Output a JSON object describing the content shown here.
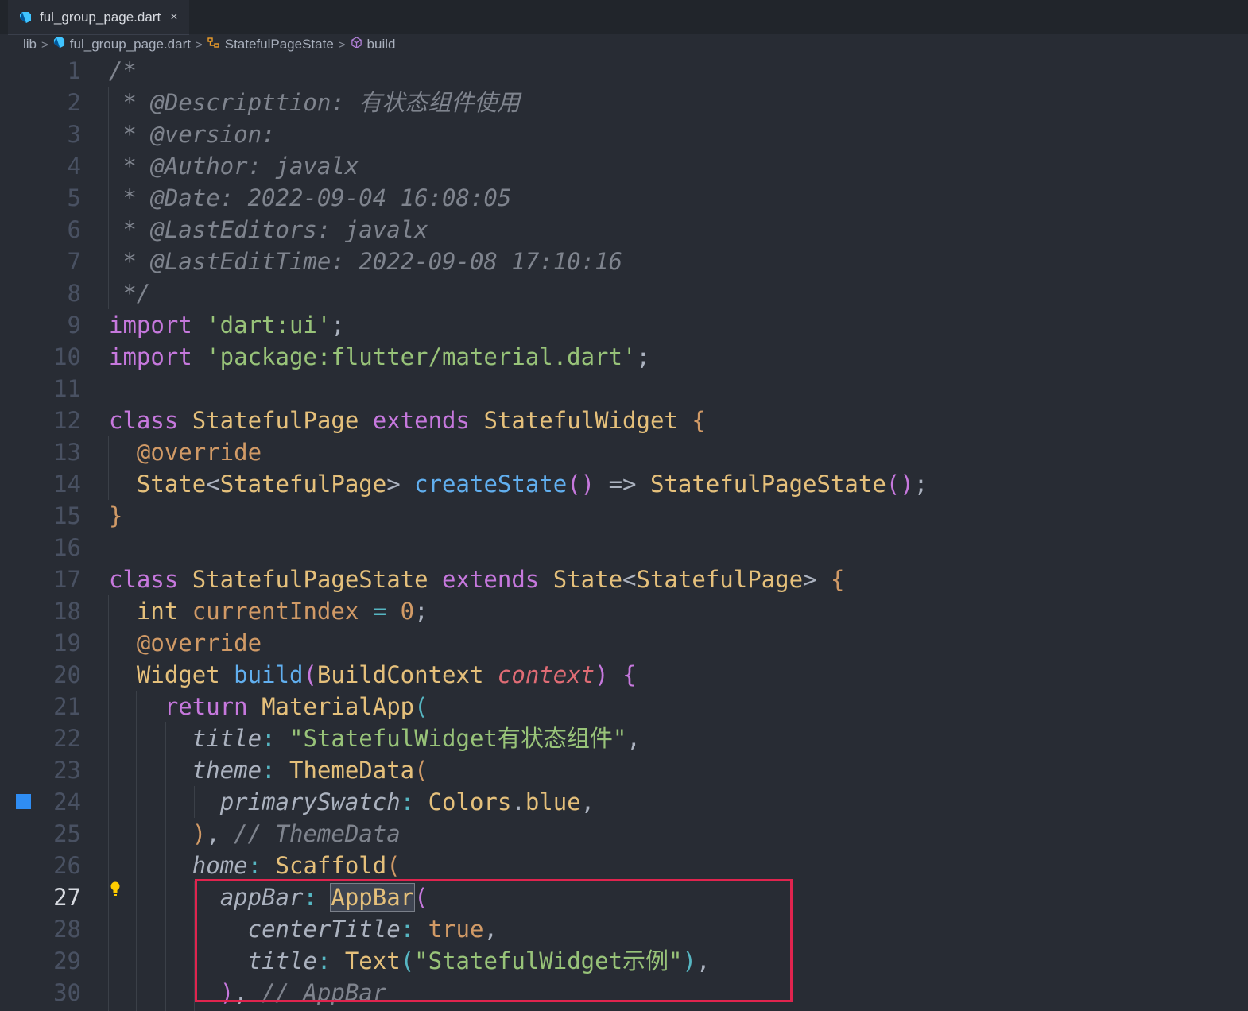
{
  "tab": {
    "filename": "ful_group_page.dart",
    "close_glyph": "×",
    "icon": "dart-icon"
  },
  "breadcrumb": {
    "items": [
      "lib",
      "ful_group_page.dart",
      "StatefulPageState",
      "build"
    ],
    "separator": ">"
  },
  "editor": {
    "active_line": 27,
    "modified_line": 24,
    "lines": [
      {
        "n": "1",
        "tokens": [
          [
            "c",
            "/*"
          ]
        ]
      },
      {
        "n": "2",
        "tokens": [
          [
            "c",
            " * @Descripttion: 有状态组件使用"
          ]
        ]
      },
      {
        "n": "3",
        "tokens": [
          [
            "c",
            " * @version:"
          ]
        ]
      },
      {
        "n": "4",
        "tokens": [
          [
            "c",
            " * @Author: javalx"
          ]
        ]
      },
      {
        "n": "5",
        "tokens": [
          [
            "c",
            " * @Date: 2022-09-04 16:08:05"
          ]
        ]
      },
      {
        "n": "6",
        "tokens": [
          [
            "c",
            " * @LastEditors: javalx"
          ]
        ]
      },
      {
        "n": "7",
        "tokens": [
          [
            "c",
            " * @LastEditTime: 2022-09-08 17:10:16"
          ]
        ]
      },
      {
        "n": "8",
        "tokens": [
          [
            "c",
            " */"
          ]
        ]
      },
      {
        "n": "9",
        "tokens": [
          [
            "kw",
            "import "
          ],
          [
            "str",
            "'dart:ui'"
          ],
          [
            "pun",
            ";"
          ]
        ]
      },
      {
        "n": "10",
        "tokens": [
          [
            "kw",
            "import "
          ],
          [
            "str",
            "'package:flutter/material.dart'"
          ],
          [
            "pun",
            ";"
          ]
        ]
      },
      {
        "n": "11",
        "tokens": []
      },
      {
        "n": "12",
        "tokens": [
          [
            "kw",
            "class "
          ],
          [
            "ty",
            "StatefulPage "
          ],
          [
            "kw",
            "extends "
          ],
          [
            "ty",
            "StatefulWidget "
          ],
          [
            "br1",
            "{"
          ]
        ]
      },
      {
        "n": "13",
        "tokens": [
          [
            "pun",
            "  "
          ],
          [
            "ann",
            "@override"
          ]
        ]
      },
      {
        "n": "14",
        "tokens": [
          [
            "pun",
            "  "
          ],
          [
            "ty",
            "State"
          ],
          [
            "pun",
            "<"
          ],
          [
            "ty",
            "StatefulPage"
          ],
          [
            "pun",
            "> "
          ],
          [
            "fn",
            "createState"
          ],
          [
            "br2",
            "()"
          ],
          [
            "pun",
            " => "
          ],
          [
            "ty",
            "StatefulPageState"
          ],
          [
            "br2",
            "()"
          ],
          [
            "pun",
            ";"
          ]
        ]
      },
      {
        "n": "15",
        "tokens": [
          [
            "br1",
            "}"
          ]
        ]
      },
      {
        "n": "16",
        "tokens": []
      },
      {
        "n": "17",
        "tokens": [
          [
            "kw",
            "class "
          ],
          [
            "ty",
            "StatefulPageState "
          ],
          [
            "kw",
            "extends "
          ],
          [
            "ty",
            "State"
          ],
          [
            "pun",
            "<"
          ],
          [
            "ty",
            "StatefulPage"
          ],
          [
            "pun",
            "> "
          ],
          [
            "br1",
            "{"
          ]
        ]
      },
      {
        "n": "18",
        "tokens": [
          [
            "pun",
            "  "
          ],
          [
            "ty",
            "int "
          ],
          [
            "num",
            "currentIndex"
          ],
          [
            "op",
            " = "
          ],
          [
            "num",
            "0"
          ],
          [
            "pun",
            ";"
          ]
        ]
      },
      {
        "n": "19",
        "tokens": [
          [
            "pun",
            "  "
          ],
          [
            "ann",
            "@override"
          ]
        ]
      },
      {
        "n": "20",
        "tokens": [
          [
            "pun",
            "  "
          ],
          [
            "ty",
            "Widget "
          ],
          [
            "fn",
            "build"
          ],
          [
            "br2",
            "("
          ],
          [
            "ty",
            "BuildContext "
          ],
          [
            "par",
            "context"
          ],
          [
            "br2",
            ")"
          ],
          [
            "pun",
            " "
          ],
          [
            "br2",
            "{"
          ]
        ]
      },
      {
        "n": "21",
        "tokens": [
          [
            "pun",
            "    "
          ],
          [
            "kw",
            "return "
          ],
          [
            "ty",
            "MaterialApp"
          ],
          [
            "br3",
            "("
          ]
        ]
      },
      {
        "n": "22",
        "tokens": [
          [
            "pun",
            "      "
          ],
          [
            "nm",
            "title"
          ],
          [
            "op",
            ": "
          ],
          [
            "str",
            "\"StatefulWidget有状态组件\""
          ],
          [
            "pun",
            ","
          ]
        ]
      },
      {
        "n": "23",
        "tokens": [
          [
            "pun",
            "      "
          ],
          [
            "nm",
            "theme"
          ],
          [
            "op",
            ": "
          ],
          [
            "ty",
            "ThemeData"
          ],
          [
            "br1",
            "("
          ]
        ]
      },
      {
        "n": "24",
        "tokens": [
          [
            "pun",
            "        "
          ],
          [
            "nm",
            "primarySwatch"
          ],
          [
            "op",
            ": "
          ],
          [
            "ty",
            "Colors"
          ],
          [
            "pun",
            "."
          ],
          [
            "prop",
            "blue"
          ],
          [
            "pun",
            ","
          ]
        ]
      },
      {
        "n": "25",
        "tokens": [
          [
            "pun",
            "      "
          ],
          [
            "br1",
            ")"
          ],
          [
            "pun",
            ", "
          ],
          [
            "c",
            "// ThemeData"
          ]
        ]
      },
      {
        "n": "26",
        "tokens": [
          [
            "pun",
            "      "
          ],
          [
            "nm",
            "home"
          ],
          [
            "op",
            ": "
          ],
          [
            "ty",
            "Scaffold"
          ],
          [
            "br1",
            "("
          ]
        ]
      },
      {
        "n": "27",
        "tokens": [
          [
            "pun",
            "        "
          ],
          [
            "nm",
            "appBar"
          ],
          [
            "op",
            ": "
          ],
          [
            "tyhl",
            "AppBar"
          ],
          [
            "br2",
            "("
          ]
        ]
      },
      {
        "n": "28",
        "tokens": [
          [
            "pun",
            "          "
          ],
          [
            "nm",
            "centerTitle"
          ],
          [
            "op",
            ": "
          ],
          [
            "num",
            "true"
          ],
          [
            "pun",
            ","
          ]
        ]
      },
      {
        "n": "29",
        "tokens": [
          [
            "pun",
            "          "
          ],
          [
            "nm",
            "title"
          ],
          [
            "op",
            ": "
          ],
          [
            "ty",
            "Text"
          ],
          [
            "br3",
            "("
          ],
          [
            "str",
            "\"StatefulWidget示例\""
          ],
          [
            "br3",
            ")"
          ],
          [
            "pun",
            ","
          ]
        ]
      },
      {
        "n": "30",
        "tokens": [
          [
            "pun",
            "        "
          ],
          [
            "br2",
            ")"
          ],
          [
            "pun",
            ", "
          ],
          [
            "c",
            "// AppBar"
          ]
        ]
      }
    ]
  }
}
